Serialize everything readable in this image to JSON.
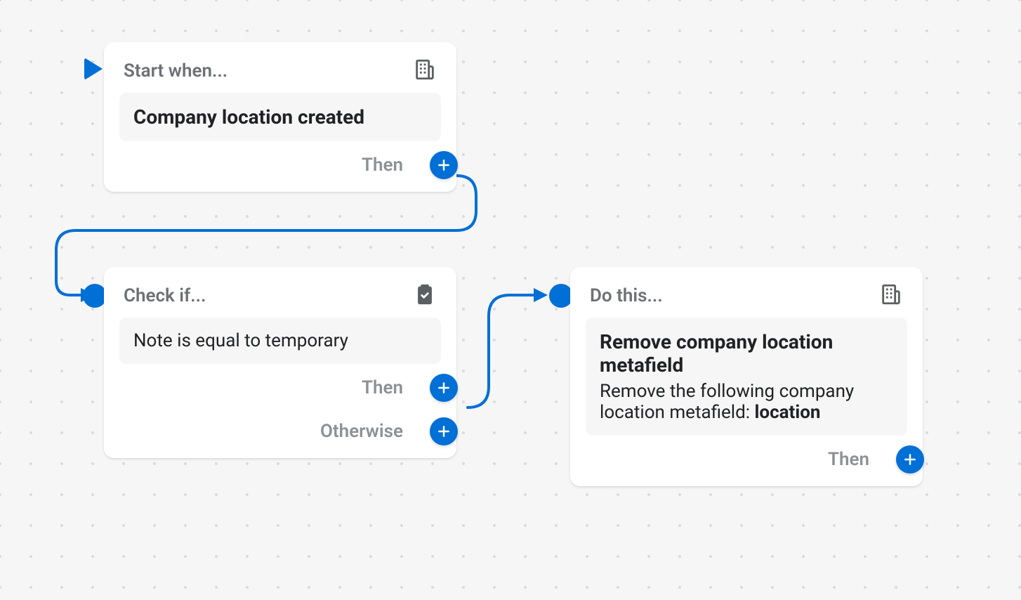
{
  "canvas": {
    "accent": "#006fd6",
    "background": "#f6f6f7"
  },
  "nodes": {
    "trigger": {
      "header": "Start when...",
      "icon": "building-icon",
      "summary": "Company location created",
      "branches": {
        "then": "Then"
      }
    },
    "condition": {
      "header": "Check if...",
      "icon": "clipboard-check-icon",
      "summary": "Note is equal to temporary",
      "branches": {
        "then": "Then",
        "otherwise": "Otherwise"
      }
    },
    "action": {
      "header": "Do this...",
      "icon": "building-icon",
      "title": "Remove company location metafield",
      "description_prefix": "Remove the following company location metafield: ",
      "description_value": "location",
      "branches": {
        "then": "Then"
      }
    }
  },
  "chart_data": {
    "type": "diagram",
    "title": "",
    "nodes": [
      {
        "id": "trigger",
        "kind": "trigger",
        "label": "Start when...",
        "summary": "Company location created"
      },
      {
        "id": "condition",
        "kind": "condition",
        "label": "Check if...",
        "summary": "Note is equal to temporary"
      },
      {
        "id": "action",
        "kind": "action",
        "label": "Do this...",
        "summary": "Remove company location metafield",
        "detail": "Remove the following company location metafield: location"
      }
    ],
    "edges": [
      {
        "from": "trigger",
        "branch": "Then",
        "to": "condition"
      },
      {
        "from": "condition",
        "branch": "Then",
        "to": "action"
      },
      {
        "from": "condition",
        "branch": "Otherwise",
        "to": null
      }
    ]
  }
}
